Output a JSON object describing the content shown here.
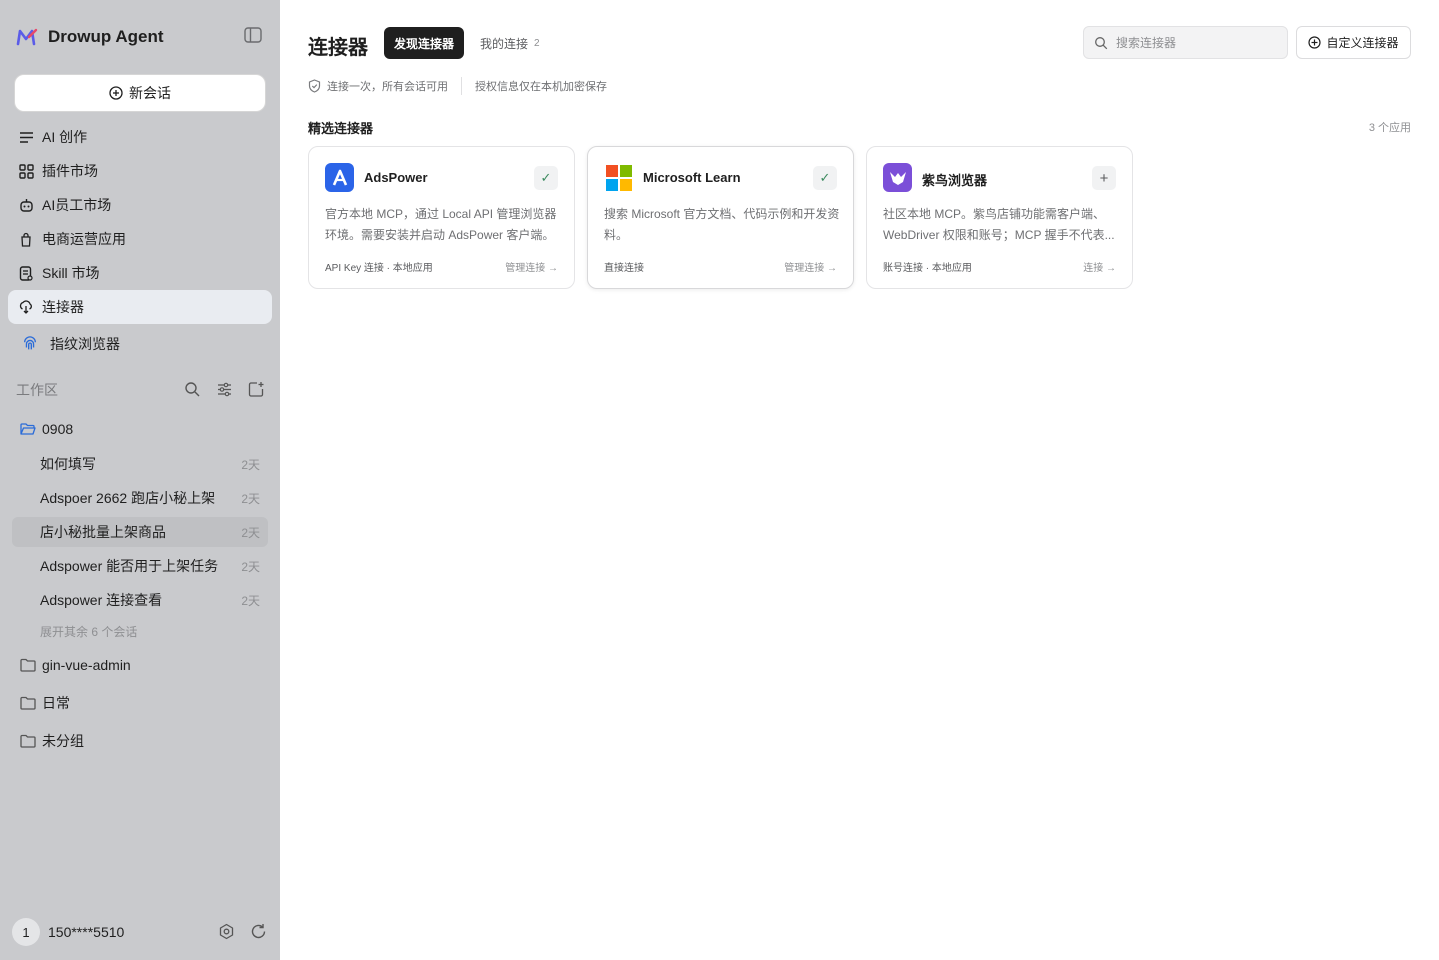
{
  "app": {
    "name": "Drowup Agent",
    "logo_color": "#5b5ce8"
  },
  "sidebar": {
    "new_chat_label": "新会话",
    "nav": [
      {
        "label": "AI 创作",
        "icon": "lines-icon"
      },
      {
        "label": "插件市场",
        "icon": "grid-icon"
      },
      {
        "label": "AI员工市场",
        "icon": "robot-icon"
      },
      {
        "label": "电商运营应用",
        "icon": "bag-icon"
      },
      {
        "label": "Skill 市场",
        "icon": "doc-icon"
      },
      {
        "label": "连接器",
        "icon": "plug-icon",
        "active": true
      },
      {
        "label": "指纹浏览器",
        "icon": "fingerprint-icon"
      }
    ],
    "workspace": {
      "title": "工作区",
      "folders": [
        {
          "name": "0908",
          "open": true,
          "conversations": [
            {
              "title": "如何填写",
              "age": "2天"
            },
            {
              "title": "Adspoer 2662 跑店小秘上架",
              "age": "2天"
            },
            {
              "title": "店小秘批量上架商品",
              "age": "2天",
              "active": true
            },
            {
              "title": "Adspower 能否用于上架任务",
              "age": "2天"
            },
            {
              "title": "Adspower 连接查看",
              "age": "2天"
            }
          ],
          "more_label": "展开其余 6 个会话"
        },
        {
          "name": "gin-vue-admin"
        },
        {
          "name": "日常"
        },
        {
          "name": "未分组"
        }
      ]
    },
    "user": {
      "avatar_text": "1",
      "name": "150****5510"
    }
  },
  "main": {
    "title": "连接器",
    "tabs": [
      {
        "label": "发现连接器",
        "active": true
      },
      {
        "label": "我的连接",
        "count": "2"
      }
    ],
    "search": {
      "placeholder": "搜索连接器",
      "value": ""
    },
    "custom_button_label": "自定义连接器",
    "notice": {
      "item1": "连接一次，所有会话可用",
      "item2": "授权信息仅在本机加密保存"
    },
    "section": {
      "title": "精选连接器",
      "count_label": "3 个应用"
    },
    "connectors": [
      {
        "name": "AdsPower",
        "logo_color": "#2b64e8",
        "connected": true,
        "state_icon": "✓",
        "description": "官方本地 MCP，通过 Local API 管理浏览器环境。需要安装并启动 AdsPower 客户端。",
        "meta": "API Key 连接 · 本地应用",
        "action": "管理连接 →"
      },
      {
        "name": "Microsoft Learn",
        "connected": true,
        "state_icon": "✓",
        "description": "搜索 Microsoft 官方文档、代码示例和开发资料。",
        "meta": "直接连接",
        "action": "管理连接 →"
      },
      {
        "name": "紫鸟浏览器",
        "logo_color": "#7b4fd8",
        "connected": false,
        "state_icon": "+",
        "description": "社区本地 MCP。紫鸟店铺功能需客户端、WebDriver 权限和账号；MCP 握手不代表...",
        "meta": "账号连接 · 本地应用",
        "action": "连接 →"
      }
    ]
  }
}
